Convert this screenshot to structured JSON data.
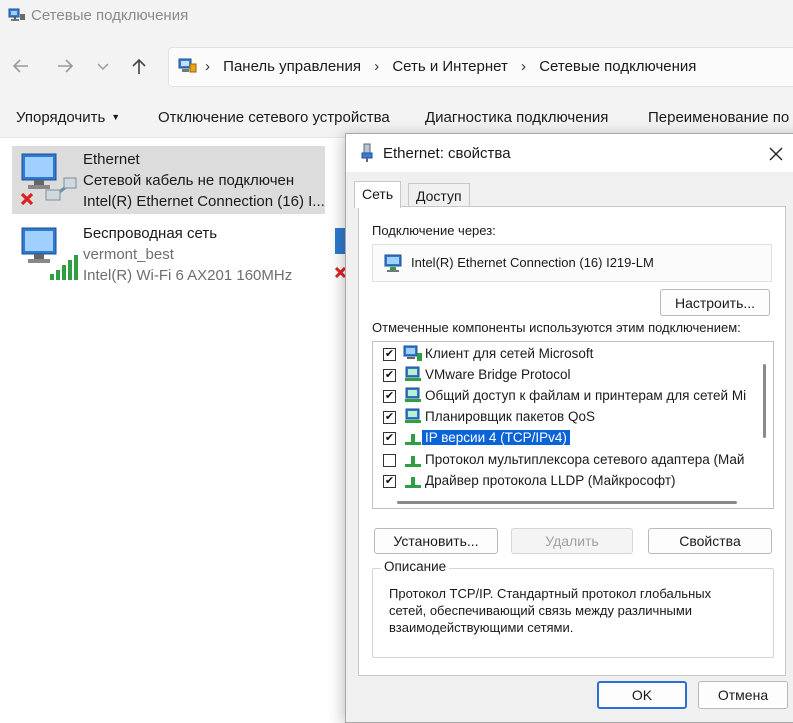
{
  "window": {
    "title": "Сетевые подключения",
    "breadcrumbs": [
      "Панель управления",
      "Сеть и Интернет",
      "Сетевые подключения"
    ]
  },
  "toolbar": {
    "organize": "Упорядочить",
    "disable_device": "Отключение сетевого устройства",
    "diagnose": "Диагностика подключения",
    "rename": "Переименование по"
  },
  "connections": [
    {
      "name": "Ethernet",
      "status": "Сетевой кабель не подключен",
      "adapter": "Intel(R) Ethernet Connection (16) I..."
    },
    {
      "name": "Беспроводная сеть",
      "status": "vermont_best",
      "adapter": "Intel(R) Wi-Fi 6 AX201 160MHz"
    }
  ],
  "dialog": {
    "title": "Ethernet: свойства",
    "tabs": [
      "Сеть",
      "Доступ"
    ],
    "connect_using_label": "Подключение через:",
    "adapter_name": "Intel(R) Ethernet Connection (16) I219-LM",
    "configure_button": "Настроить...",
    "components_label": "Отмеченные компоненты используются этим подключением:",
    "components": [
      {
        "label": "Клиент для сетей Microsoft",
        "checked": "✔"
      },
      {
        "label": "VMware Bridge Protocol",
        "checked": "✔"
      },
      {
        "label": "Общий доступ к файлам и принтерам для сетей Mi",
        "checked": "✔"
      },
      {
        "label": "Планировщик пакетов QoS",
        "checked": "✔"
      },
      {
        "label": "IP версии 4 (TCP/IPv4)",
        "checked": "✔"
      },
      {
        "label": "Протокол мультиплексора сетевого адаптера (Май",
        "checked": ""
      },
      {
        "label": "Драйвер протокола LLDP (Майкрософт)",
        "checked": "✔"
      }
    ],
    "install_button": "Установить...",
    "uninstall_button": "Удалить",
    "properties_button": "Свойства",
    "description_legend": "Описание",
    "description_text": "Протокол TCP/IP. Стандартный протокол глобальных сетей, обеспечивающий связь между различными взаимодействующими сетями.",
    "ok_button": "OK",
    "cancel_button": "Отмена"
  },
  "icons": {
    "window": "network-connections-icon",
    "address": "control-panel-icon",
    "ethernet": "ethernet-adapter-icon",
    "wifi": "wifi-adapter-icon"
  },
  "colors": {
    "selection": "#0a64d8",
    "selected_item": "#dcdcdc",
    "default_button_border": "#2b6fd6"
  }
}
